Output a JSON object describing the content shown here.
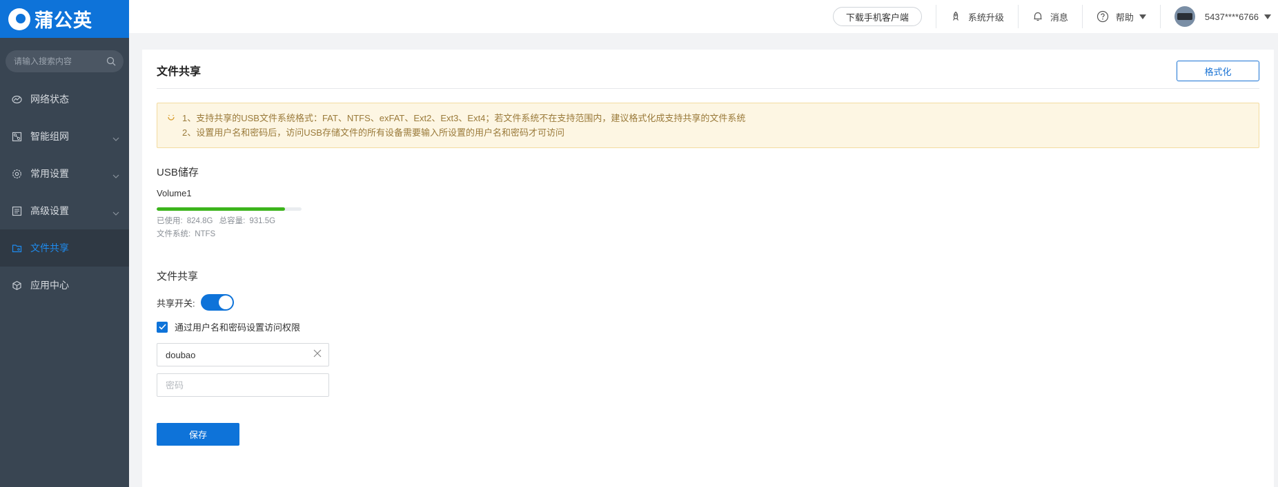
{
  "app": {
    "logo_text": "蒲公英"
  },
  "sidebar": {
    "search_placeholder": "请输入搜索内容",
    "items": [
      {
        "label": "网络状态",
        "icon": "network-status-icon",
        "has_submenu": false,
        "active": false
      },
      {
        "label": "智能组网",
        "icon": "smart-network-icon",
        "has_submenu": true,
        "active": false
      },
      {
        "label": "常用设置",
        "icon": "gear-icon",
        "has_submenu": true,
        "active": false
      },
      {
        "label": "高级设置",
        "icon": "advanced-settings-icon",
        "has_submenu": true,
        "active": false
      },
      {
        "label": "文件共享",
        "icon": "folder-share-icon",
        "has_submenu": false,
        "active": true
      },
      {
        "label": "应用中心",
        "icon": "app-cube-icon",
        "has_submenu": false,
        "active": false
      }
    ]
  },
  "topbar": {
    "download_label": "下载手机客户端",
    "upgrade_label": "系统升级",
    "messages_label": "消息",
    "help_label": "帮助",
    "account_label": "5437****6766"
  },
  "page": {
    "title": "文件共享",
    "format_button": "格式化",
    "notice": {
      "line1": "1、支持共享的USB文件系统格式：FAT、NTFS、exFAT、Ext2、Ext3、Ext4；若文件系统不在支持范围内，建议格式化成支持共享的文件系统",
      "line2": "2、设置用户名和密码后，访问USB存储文件的所有设备需要输入所设置的用户名和密码才可访问"
    },
    "usb": {
      "section_title": "USB储存",
      "volume_name": "Volume1",
      "used_label": "已使用:",
      "used_value": "824.8G",
      "total_label": "总容量:",
      "total_value": "931.5G",
      "fs_label": "文件系统:",
      "fs_value": "NTFS",
      "usage_fraction": 0.885
    },
    "share": {
      "section_title": "文件共享",
      "switch_label": "共享开关:",
      "switch_on": true,
      "auth_checkbox_label": "通过用户名和密码设置访问权限",
      "auth_checked": true,
      "username_value": "doubao",
      "password_placeholder": "密码",
      "save_label": "保存"
    }
  },
  "colors": {
    "brand": "#0e73d9",
    "sidebar_bg": "#394552",
    "active_nav": "#1e8cf0",
    "progress": "#3cb41c",
    "notice_bg": "#fdf6e3",
    "notice_text": "#9a7a3a"
  }
}
